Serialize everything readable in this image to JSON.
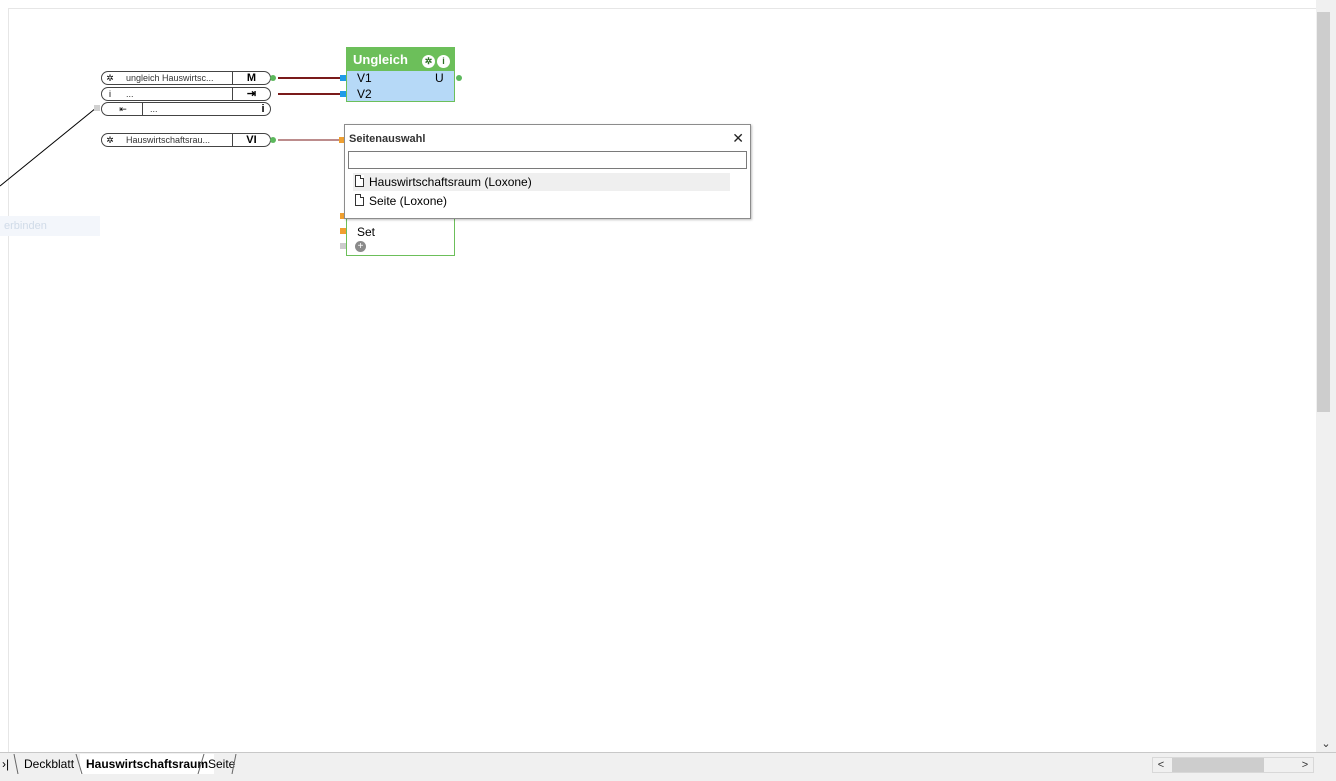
{
  "logic_block": {
    "title": "Ungleich",
    "settings_icon": "gear-icon",
    "info_icon": "info-icon",
    "inputs": [
      {
        "label": "V1"
      },
      {
        "label": "V2"
      }
    ],
    "output_label": "U",
    "second_block_label": "Set"
  },
  "input_blocks": [
    {
      "name": "ungleich Hauswirtsc...",
      "type": "M"
    },
    {
      "name": "...",
      "type": ""
    },
    {
      "name": "...",
      "type": ""
    },
    {
      "name": "Hauswirtschaftsrau...",
      "type": "VI"
    }
  ],
  "ghost_label": "erbinden",
  "popup": {
    "title": "Seitenauswahl",
    "close_glyph": "✕",
    "search_value": "",
    "items": [
      {
        "label": "Hauswirtschaftsraum (Loxone)",
        "selected": true
      },
      {
        "label": "Seite (Loxone)",
        "selected": false
      }
    ]
  },
  "tabs": {
    "nav_glyph": "›|",
    "items": [
      {
        "label": "Deckblatt",
        "active": false
      },
      {
        "label": "Hauswirtschaftsraum",
        "active": true
      },
      {
        "label": "Seite",
        "active": false
      }
    ]
  },
  "scrollbars": {
    "left_arrow": "<",
    "right_arrow": ">",
    "down_arrow": "⌄"
  },
  "colors": {
    "block_header": "#6cbf5a",
    "block_body": "#b6d9f7",
    "wire": "#7a1a1a",
    "port_input": "#1f9be8",
    "port_output": "#5cb85c"
  }
}
